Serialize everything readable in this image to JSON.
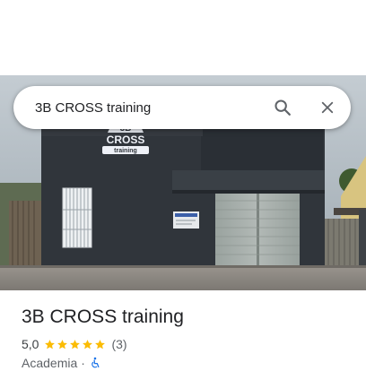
{
  "search": {
    "value": "3B CROSS training"
  },
  "photo": {
    "sign_line1": "CROSS",
    "sign_line2": "training"
  },
  "place": {
    "name": "3B CROSS training",
    "rating": "5,0",
    "rating_value": 5,
    "rating_max": 5,
    "review_count": "(3)",
    "category": "Academia",
    "separator": "·"
  },
  "colors": {
    "star": "#fbbc04",
    "accessibility_icon": "#1a73e8",
    "building": "#2f343a",
    "shutter": "#a3aba8",
    "ground": "#8c8781"
  },
  "icons": {
    "search": "search-icon",
    "close": "close-icon",
    "accessibility": "wheelchair-icon"
  }
}
